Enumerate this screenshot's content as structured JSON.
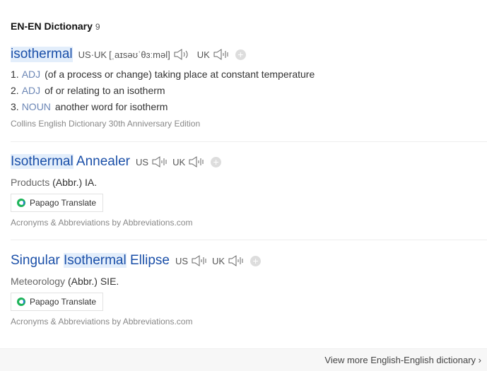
{
  "header": {
    "title": "EN-EN Dictionary",
    "count": "9"
  },
  "entries": [
    {
      "word": "isothermal",
      "us_uk": "US·UK",
      "phonetic": "[ˌaɪsəʊˈθɜːməl]",
      "uk": "UK",
      "definitions": [
        {
          "num": "1.",
          "pos": "ADJ",
          "text": "(of a process or change) taking place at constant temperature"
        },
        {
          "num": "2.",
          "pos": "ADJ",
          "text": "of or relating to an isotherm"
        },
        {
          "num": "3.",
          "pos": "NOUN",
          "text": "another word for isotherm"
        }
      ],
      "source": "Collins English Dictionary 30th Anniversary Edition"
    },
    {
      "word_hl": "Isothermal",
      "word_rest": " Annealer",
      "us": "US",
      "uk": "UK",
      "category": "Products",
      "abbr": "(Abbr.) IA.",
      "button": "Papago Translate",
      "source": "Acronyms & Abbreviations by Abbreviations.com"
    },
    {
      "word_pre": "Singular ",
      "word_hl": "Isothermal",
      "word_rest": " Ellipse",
      "us": "US",
      "uk": "UK",
      "category": "Meteorology",
      "abbr": "(Abbr.) SIE.",
      "button": "Papago Translate",
      "source": "Acronyms & Abbreviations by Abbreviations.com"
    }
  ],
  "footer": {
    "more": "View more English-English dictionary ›"
  }
}
